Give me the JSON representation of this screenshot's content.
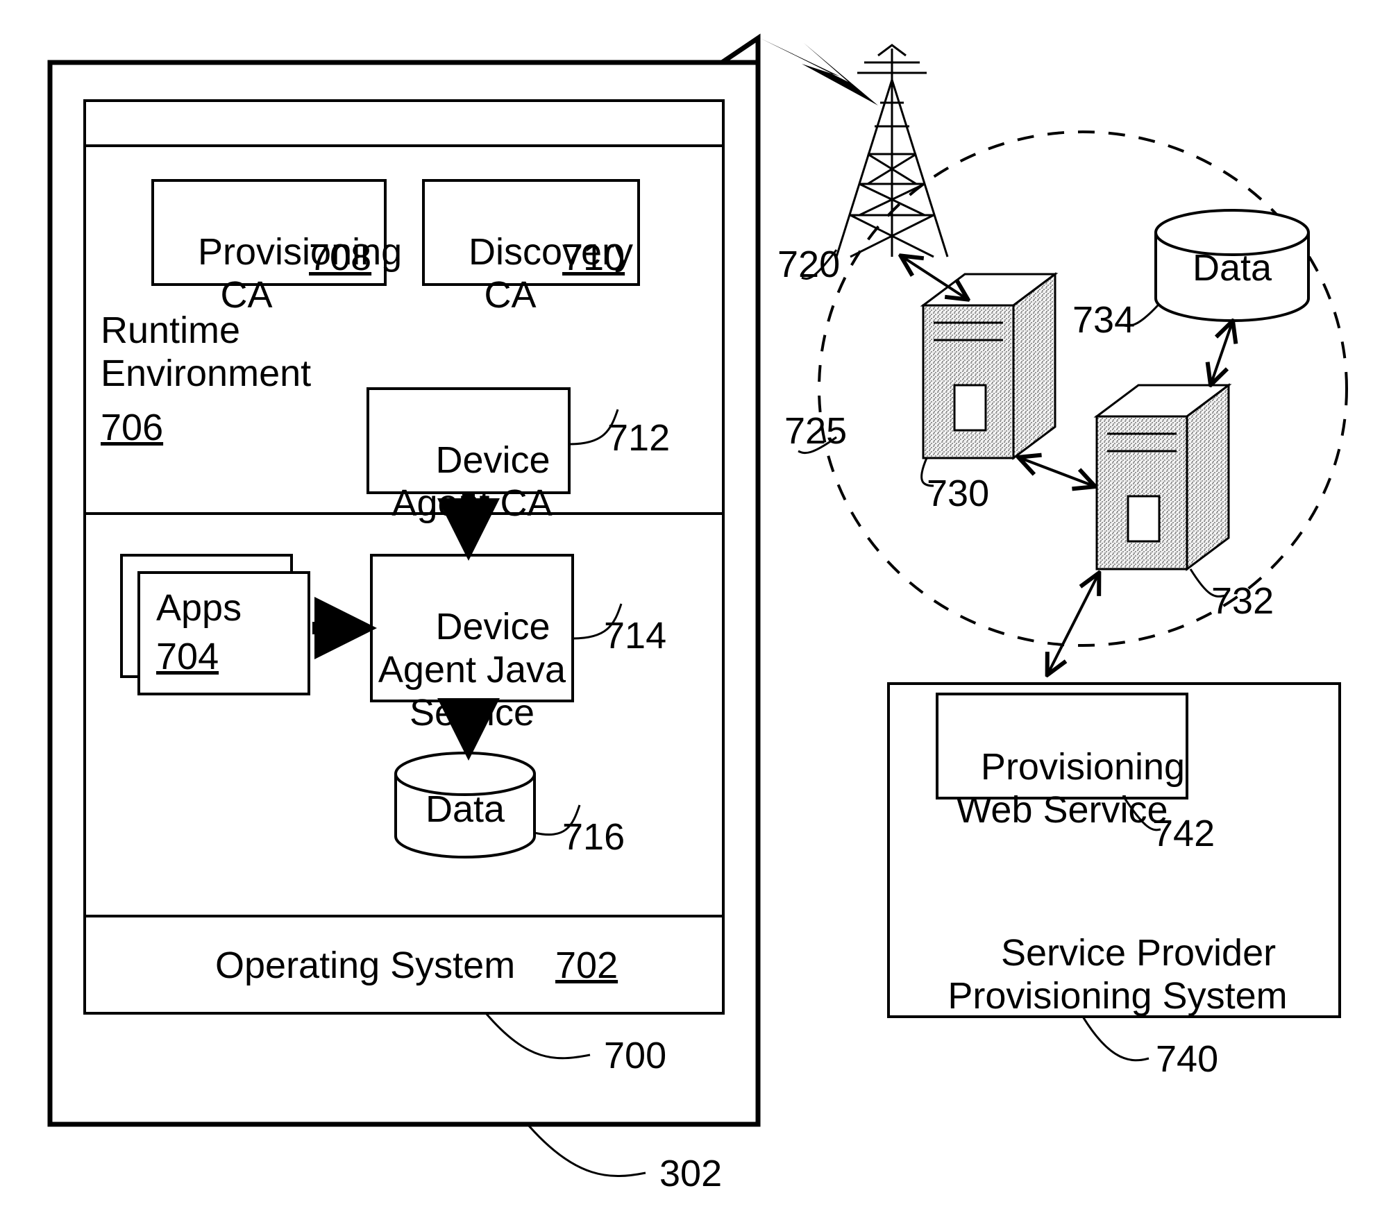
{
  "device": {
    "ref": "302",
    "stack": {
      "ref": "700",
      "runtime": {
        "label": "Runtime\nEnvironment",
        "ref": "706",
        "provisioning_ca": {
          "label": "Provisioning\nCA",
          "ref": "708"
        },
        "discovery_ca": {
          "label": "Discovery\nCA",
          "ref": "710"
        },
        "device_agent_ca": {
          "label": "Device\nAgent CA",
          "ref": "712"
        }
      },
      "middle": {
        "apps": {
          "label": "Apps",
          "ref": "704"
        },
        "device_agent_java": {
          "label": "Device\nAgent Java\nService",
          "ref": "714"
        },
        "local_data": {
          "label": "Data",
          "ref": "716"
        }
      },
      "os": {
        "label": "Operating System",
        "ref": "702"
      }
    }
  },
  "network": {
    "tower_ref": "720",
    "carrier_cloud_ref": "725",
    "server_a_ref": "730",
    "server_b_ref": "732",
    "cloud_data": {
      "label": "Data",
      "ref": "734"
    }
  },
  "service_provider": {
    "title": "Service Provider\nProvisioning System",
    "ref": "740",
    "web_service": {
      "label": "Provisioning\nWeb Service",
      "ref": "742"
    }
  }
}
